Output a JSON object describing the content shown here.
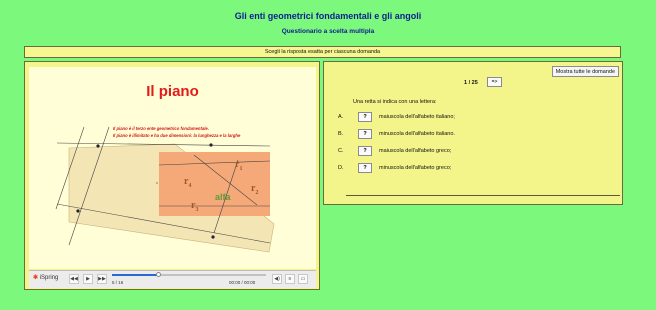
{
  "header": {
    "title": "Gli enti geometrici fondamentali e gli angoli",
    "subtitle": "Questionario a scelta multipla",
    "instruction": "Scegli la risposta esatta per ciascuna domanda"
  },
  "slide": {
    "title": "Il piano",
    "line1": "Il piano è il terzo ente geometrico fondamentale.",
    "line2": "Il piano è illimitato e ha due dimensioni: la lunghezza e la larghe",
    "labels": {
      "r1": "r",
      "r1s": "1",
      "r2": "r",
      "r2s": "2",
      "r3": "r",
      "r3s": "3",
      "r4": "r",
      "r4s": "4",
      "alfa": "alfa"
    }
  },
  "player": {
    "logo_prefix": "iSpring",
    "slide_counter": "5 / 16",
    "timecode": "00:00 / 00:00",
    "progress": 0.3
  },
  "quiz": {
    "show_all_label": "Mostra tutte le domande",
    "counter": "1 / 25",
    "next_label": "=>",
    "question": "Una retta si indica con una lettera:",
    "answer_button": "?",
    "options": [
      {
        "letter": "A.",
        "text": "maiuscola dell'alfabeto italiano;"
      },
      {
        "letter": "B.",
        "text": "minuscola dell'alfabeto italiano."
      },
      {
        "letter": "C.",
        "text": "maiuscola dell'alfabeto greco;"
      },
      {
        "letter": "D.",
        "text": "minuscola dell'alfabeto greco;"
      }
    ]
  },
  "colors": {
    "background": "#7cf87c",
    "panel": "#f3f48a",
    "title": "#0b1f8f",
    "slide_title": "#e21c1c"
  }
}
